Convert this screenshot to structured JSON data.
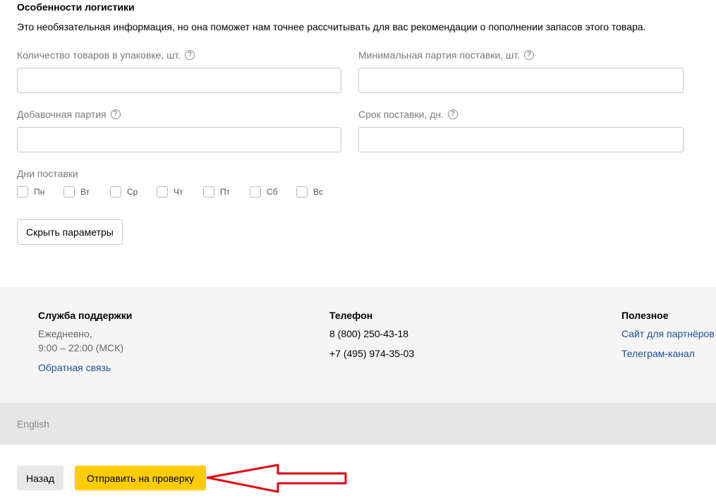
{
  "logistics": {
    "title": "Особенности логистики",
    "description": "Это необязательная информация, но она поможет нам точнее рассчитывать для вас рекомендации о пополнении запасов этого товара.",
    "fields": {
      "pack_qty": {
        "label": "Количество товаров в упаковке, шт.",
        "value": ""
      },
      "min_batch": {
        "label": "Минимальная партия поставки, шт.",
        "value": ""
      },
      "add_batch": {
        "label": "Добавочная партия",
        "value": ""
      },
      "lead_time": {
        "label": "Срок поставки, дн.",
        "value": ""
      }
    },
    "help_glyph": "?",
    "days_label": "Дни поставки",
    "days": [
      "Пн",
      "Вт",
      "Ср",
      "Чт",
      "Пт",
      "Сб",
      "Вс"
    ],
    "days_checked": [
      false,
      false,
      false,
      false,
      false,
      false,
      false
    ],
    "hide_button": "Скрыть параметры"
  },
  "footer": {
    "support": {
      "heading": "Служба поддержки",
      "hours_line1": "Ежедневно,",
      "hours_line2": "9:00 – 22:00 (МСК)",
      "feedback_link": "Обратная связь"
    },
    "phone": {
      "heading": "Телефон",
      "numbers": [
        "8 (800) 250-43-18",
        "+7 (495) 974-35-03"
      ]
    },
    "useful": {
      "heading": "Полезное",
      "links": [
        "Сайт для партнёров",
        "Телеграм-канал"
      ]
    },
    "language": "English"
  },
  "actions": {
    "back": "Назад",
    "submit": "Отправить на проверку"
  },
  "colors": {
    "submit_bg": "#ffcc00",
    "link": "#1a4f9c",
    "annotation_arrow": "#e30613"
  },
  "icons": {
    "help": "help-circle-icon",
    "annotation": "arrow-left-icon"
  }
}
